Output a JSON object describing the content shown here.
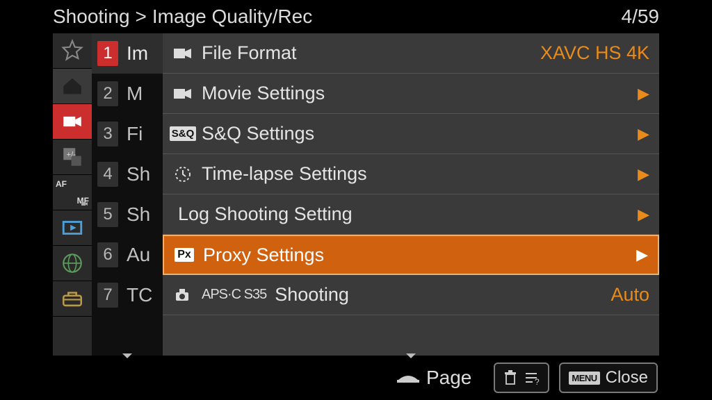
{
  "breadcrumb": {
    "root": "Shooting",
    "sep": ">",
    "sub": "Image Quality/Rec",
    "counter": "4/59"
  },
  "submenu": [
    {
      "n": "1",
      "label": "Im",
      "active": true
    },
    {
      "n": "2",
      "label": "M"
    },
    {
      "n": "3",
      "label": "Fi"
    },
    {
      "n": "4",
      "label": "Sh"
    },
    {
      "n": "5",
      "label": "Sh"
    },
    {
      "n": "6",
      "label": "Au"
    },
    {
      "n": "7",
      "label": "TC"
    }
  ],
  "items": {
    "file_format": {
      "label": "File Format",
      "value": "XAVC HS 4K"
    },
    "movie_settings": {
      "label": "Movie Settings"
    },
    "sq_settings": {
      "badge": "S&Q",
      "label": "S&Q Settings"
    },
    "timelapse": {
      "label": "Time-lapse Settings"
    },
    "log_shooting": {
      "label": "Log Shooting Setting"
    },
    "proxy": {
      "badge": "Px",
      "label": "Proxy Settings"
    },
    "apsc": {
      "tag": "APS·C S35",
      "label": "Shooting",
      "value": "Auto"
    }
  },
  "footer": {
    "page": "Page",
    "close": "Close",
    "menu_badge": "MENU"
  }
}
